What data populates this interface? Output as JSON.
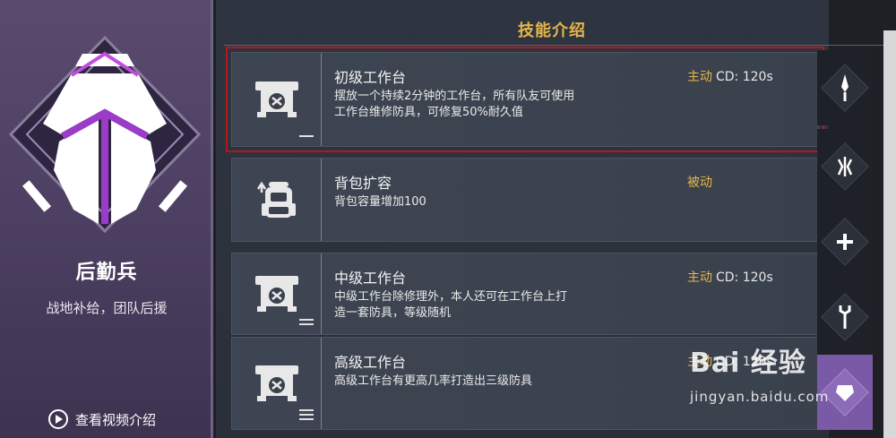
{
  "class_panel": {
    "name": "后勤兵",
    "description": "战地补给，团队后援",
    "video_link": "查看视频介绍"
  },
  "section": {
    "title": "技能介绍"
  },
  "skills": [
    {
      "name": "初级工作台",
      "type": "主动",
      "cd": "CD: 120s",
      "lines": [
        "摆放一个持续2分钟的工作台，所有队友可使用",
        "工作台维修防具，可修复50%耐久值"
      ],
      "icon": "workbench-icon",
      "level": 1,
      "selected": true
    },
    {
      "name": "背包扩容",
      "type": "被动",
      "cd": "",
      "lines": [
        "背包容量增加100"
      ],
      "icon": "backpack-upgrade-icon",
      "level": 0,
      "selected": false
    },
    {
      "name": "中级工作台",
      "type": "主动",
      "cd": "CD: 120s",
      "lines": [
        "中级工作台除修理外，本人还可在工作台上打",
        "造一套防具，等级随机"
      ],
      "icon": "workbench-icon",
      "level": 2,
      "selected": false
    },
    {
      "name": "高级工作台",
      "type": "主动",
      "cd": "CD: 120s",
      "lines": [
        "高级工作台有更高几率打造出三级防具"
      ],
      "icon": "workbench-icon",
      "level": 3,
      "selected": false
    }
  ],
  "rail": [
    {
      "name": "knife-icon",
      "active": false
    },
    {
      "name": "claw-icon",
      "active": false
    },
    {
      "name": "plus-icon",
      "active": false
    },
    {
      "name": "wrench-icon",
      "active": false
    },
    {
      "name": "armor-icon",
      "active": true
    }
  ],
  "watermark": {
    "brand": "Bai 经验",
    "url": "jingyan.baidu.com"
  },
  "colors": {
    "accent_gold": "#e6b54a",
    "selection_red": "#b3191c",
    "class_purple": "#7a5aa6"
  }
}
